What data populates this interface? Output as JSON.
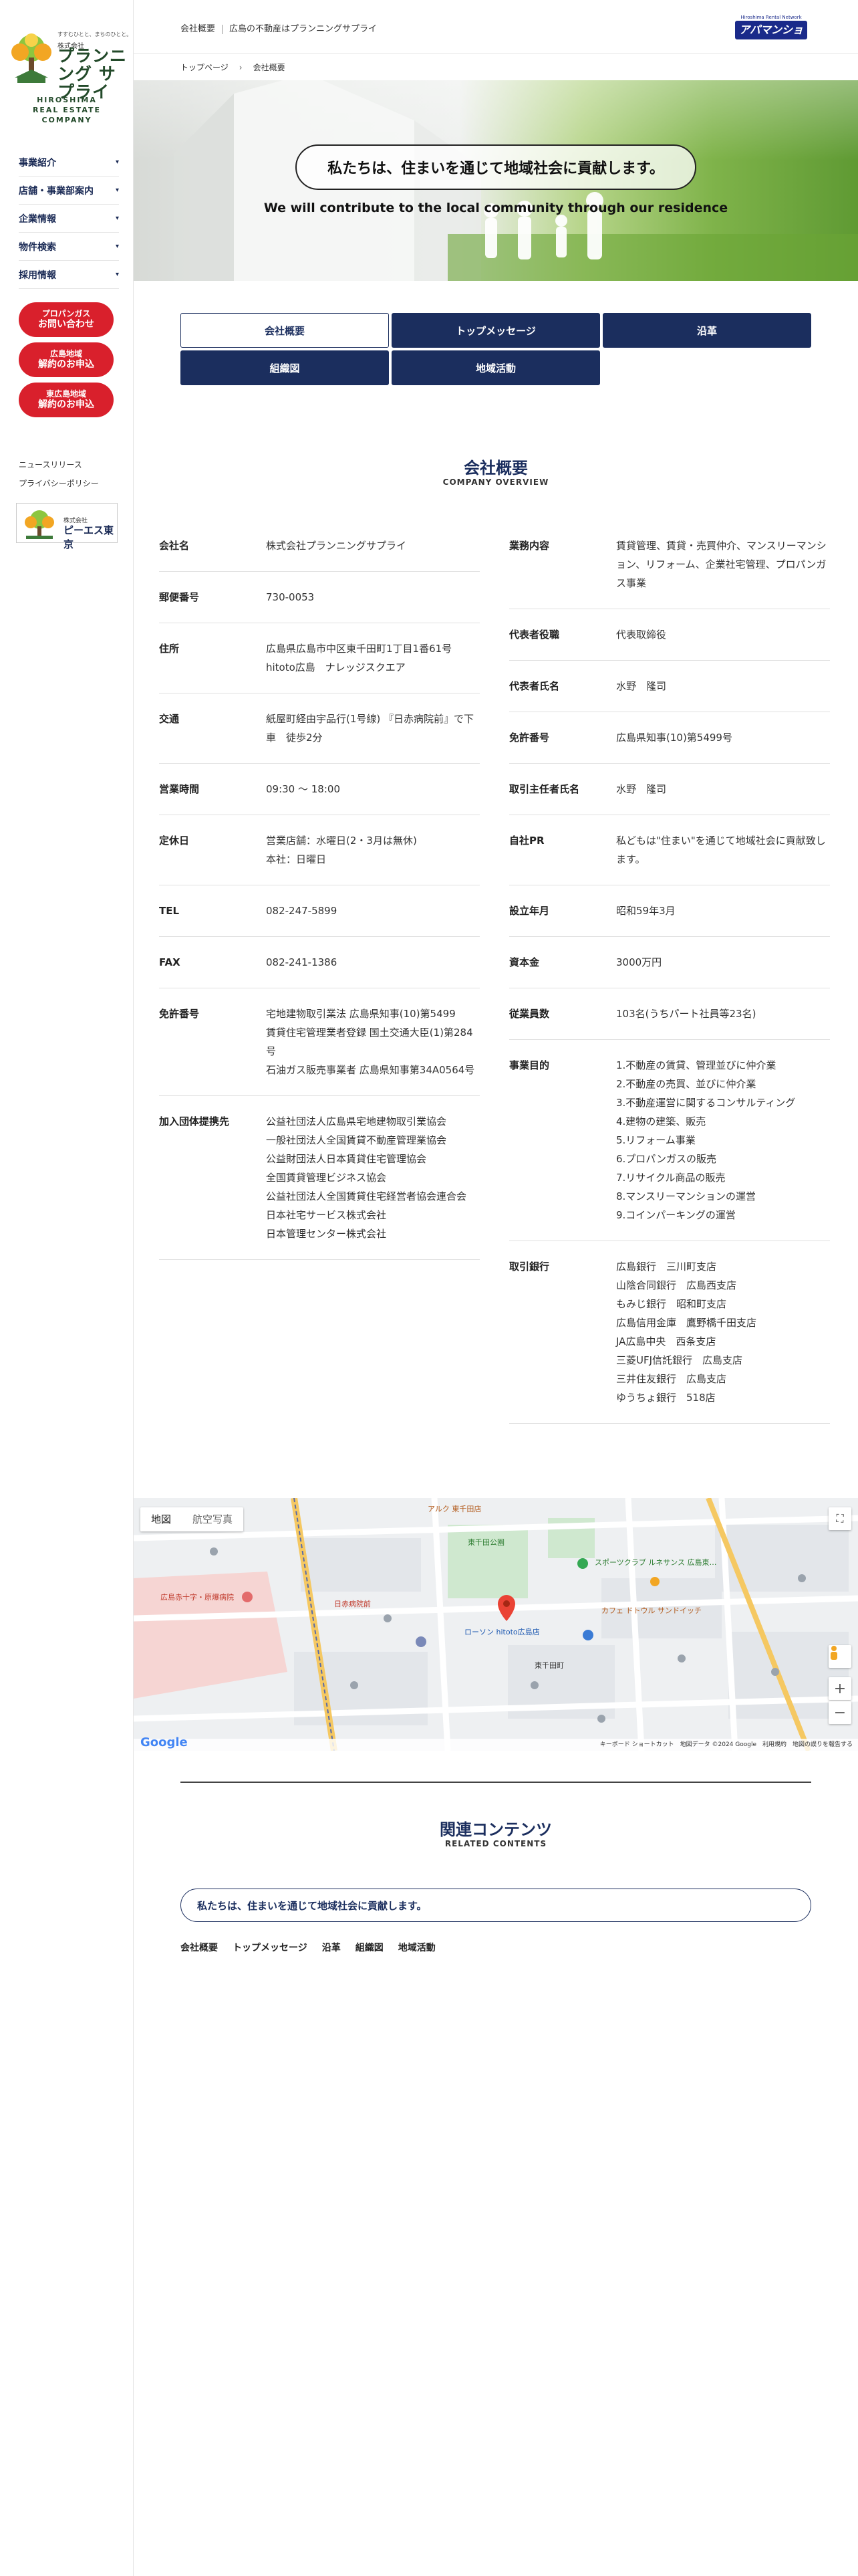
{
  "sidebar": {
    "logo_tagline": "すすむひとと、まちのひとと。",
    "logo_sub": "株式会社",
    "logo_name": "プランニング サプライ",
    "logo_en_1": "HIROSHIMA",
    "logo_en_2": "REAL ESTATE COMPANY",
    "nav": [
      {
        "label": "事業紹介"
      },
      {
        "label": "店舗・事業部案内"
      },
      {
        "label": "企業情報"
      },
      {
        "label": "物件検索"
      },
      {
        "label": "採用情報"
      }
    ],
    "cta": [
      {
        "line1": "プロパンガス",
        "line2": "お問い合わせ"
      },
      {
        "line1": "広島地域",
        "line2": "解約のお申込"
      },
      {
        "line1": "東広島地域",
        "line2": "解約のお申込"
      }
    ],
    "news": "ニュースリリース",
    "privacy": "プライバシーポリシー",
    "pes_small": "株式会社",
    "pes_big": "ピーエス東京"
  },
  "header": {
    "page": "会社概要",
    "tagline": "広島の不動産はプランニングサプライ",
    "aman_top": "Hiroshima Rental Network",
    "aman_name": "アパマンショップ"
  },
  "breadcrumb": {
    "home": "トップページ",
    "current": "会社概要"
  },
  "hero": {
    "title": "私たちは、住まいを通じて地域社会に貢献します。",
    "subtitle": "We will contribute to the local community through our residence"
  },
  "tabs": [
    "会社概要",
    "トップメッセージ",
    "沿革",
    "組織図",
    "地域活動"
  ],
  "section": {
    "title": "会社概要",
    "subtitle": "COMPANY OVERVIEW"
  },
  "company_left": [
    {
      "k": "会社名",
      "v": "株式会社プランニングサプライ"
    },
    {
      "k": "郵便番号",
      "v": "730-0053"
    },
    {
      "k": "住所",
      "v": "広島県広島市中区東千田町1丁目1番61号\nhitoto広島　ナレッジスクエア"
    },
    {
      "k": "交通",
      "v": "紙屋町経由宇品行(1号線) 『日赤病院前』で下車　徒歩2分"
    },
    {
      "k": "営業時間",
      "v": "09:30 〜 18:00"
    },
    {
      "k": "定休日",
      "v": "営業店舗：水曜日(2・3月は無休)\n本社：日曜日"
    },
    {
      "k": "TEL",
      "v": "082-247-5899"
    },
    {
      "k": "FAX",
      "v": "082-241-1386"
    },
    {
      "k": "免許番号",
      "v": "宅地建物取引業法 広島県知事(10)第5499\n賃貸住宅管理業者登録 国土交通大臣(1)第284号\n石油ガス販売事業者 広島県知事第34A0564号"
    },
    {
      "k": "加入団体提携先",
      "v": "公益社団法人広島県宅地建物取引業協会\n一般社団法人全国賃貸不動産管理業協会\n公益財団法人日本賃貸住宅管理協会\n全国賃貸管理ビジネス協会\n公益社団法人全国賃貸住宅経営者協会連合会\n日本社宅サービス株式会社\n日本管理センター株式会社"
    }
  ],
  "company_right": [
    {
      "k": "業務内容",
      "v": "賃貸管理、賃貸・売買仲介、マンスリーマンション、リフォーム、企業社宅管理、プロパンガス事業"
    },
    {
      "k": "代表者役職",
      "v": "代表取締役"
    },
    {
      "k": "代表者氏名",
      "v": "水野　隆司"
    },
    {
      "k": "免許番号",
      "v": "広島県知事(10)第5499号"
    },
    {
      "k": "取引主任者氏名",
      "v": "水野　隆司"
    },
    {
      "k": "自社PR",
      "v": "私どもは\"住まい\"を通じて地域社会に貢献致します。"
    },
    {
      "k": "設立年月",
      "v": "昭和59年3月"
    },
    {
      "k": "資本金",
      "v": "3000万円"
    },
    {
      "k": "従業員数",
      "v": "103名(うちパート社員等23名)"
    },
    {
      "k": "事業目的",
      "v": "1.不動産の賃貸、管理並びに仲介業\n2.不動産の売買、並びに仲介業\n3.不動産運営に関するコンサルティング\n4.建物の建築、販売\n5.リフォーム事業\n6.プロパンガスの販売\n7.リサイクル商品の販売\n8.マンスリーマンションの運営\n9.コインパーキングの運営"
    },
    {
      "k": "取引銀行",
      "v": "広島銀行　三川町支店\n山陰合同銀行　広島西支店\nもみじ銀行　昭和町支店\n広島信用金庫　鷹野橋千田支店\nJA広島中央　西条支店\n三菱UFJ信託銀行　広島支店\n三井住友銀行　広島支店\nゆうちょ銀行　518店"
    }
  ],
  "map": {
    "tab_map": "地図",
    "tab_sat": "航空写真",
    "footer": "キーボード ショートカット　地図データ ©2024 Google　利用規約　地図の誤りを報告する",
    "google": "Google",
    "labels": {
      "l1": "アルク 東千田店",
      "l2": "日赤病院前",
      "l3": "東千田公園",
      "l4": "スポーツクラブ ルネサンス 広島東…",
      "l5": "ローソン hitoto広島店",
      "l6": "東千田町",
      "l7": "広島赤十字・原爆病院",
      "l8": "カフェ ドトウル サンドイッチ"
    }
  },
  "related": {
    "title": "関連コンテンツ",
    "subtitle": "RELATED CONTENTS",
    "box": "私たちは、住まいを通じて地域社会に貢献します。",
    "links": [
      "会社概要",
      "トップメッセージ",
      "沿革",
      "組織図",
      "地域活動"
    ]
  },
  "colors": {
    "navy": "#1b2e5e",
    "red": "#d9202c",
    "green": "#234a2a"
  }
}
